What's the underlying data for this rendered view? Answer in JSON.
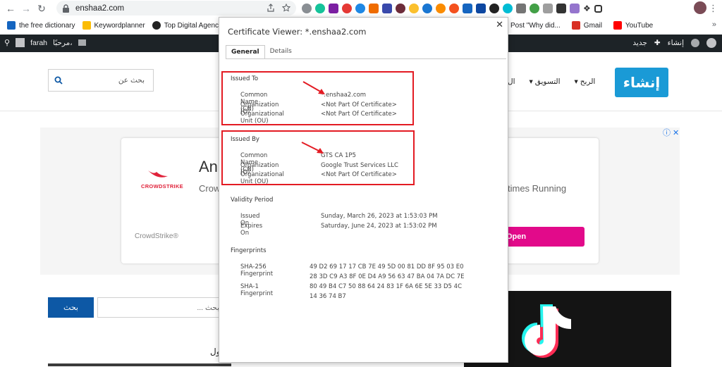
{
  "browser": {
    "url": "enshaa2.com",
    "bookmarks": [
      {
        "label": "the free dictionary",
        "color": "#1565c0"
      },
      {
        "label": "Keywordplanner",
        "color": "#fbbc04"
      },
      {
        "label": "Top Digital Agency",
        "color": "#222"
      }
    ],
    "bookmarks_right": [
      {
        "label": "Post \"Why did...",
        "color": "#e8710a"
      },
      {
        "label": "Gmail",
        "color": "#d93025"
      },
      {
        "label": "YouTube",
        "color": "#ff0000"
      }
    ]
  },
  "wp_bar": {
    "user": "farah",
    "greeting": "مرحبًا،",
    "site": "إنشاء",
    "new": "جديد"
  },
  "site": {
    "search_placeholder": "بحث عن",
    "menu": [
      "الربح",
      "التسويق",
      "ال"
    ],
    "logo": "إنشاء",
    "search_button": "بحث",
    "search2_placeholder": "بحث ...",
    "bottom_text": "ول"
  },
  "ad": {
    "title": "An",
    "subtitle": "Crow",
    "right_text": "times Running",
    "brand": "CrowdStrike®",
    "logo_text": "CROWDSTRIKE",
    "cta": "Open"
  },
  "dialog": {
    "title": "Certificate Viewer: *.enshaa2.com",
    "tabs": [
      "General",
      "Details"
    ],
    "issued_to": {
      "heading": "Issued To",
      "rows": [
        {
          "k": "Common Name (CN)",
          "v": "*.enshaa2.com"
        },
        {
          "k": "Organization (O)",
          "v": "<Not Part Of Certificate>"
        },
        {
          "k": "Organizational Unit (OU)",
          "v": "<Not Part Of Certificate>"
        }
      ]
    },
    "issued_by": {
      "heading": "Issued By",
      "rows": [
        {
          "k": "Common Name (CN)",
          "v": "GTS CA 1P5"
        },
        {
          "k": "Organization (O)",
          "v": "Google Trust Services LLC"
        },
        {
          "k": "Organizational Unit (OU)",
          "v": "<Not Part Of Certificate>"
        }
      ]
    },
    "validity": {
      "heading": "Validity Period",
      "rows": [
        {
          "k": "Issued On",
          "v": "Sunday, March 26, 2023 at 1:53:03 PM"
        },
        {
          "k": "Expires On",
          "v": "Saturday, June 24, 2023 at 1:53:02 PM"
        }
      ]
    },
    "fingerprints": {
      "heading": "Fingerprints",
      "sha256_label": "SHA-256 Fingerprint",
      "sha256_line1": "49 D2 69 17 17 CB 7E 49 5D 00 81 DD 8F 95 03 E0",
      "sha256_line2": "28 3D C9 A3 8F 0E D4 A9 56 63 47 BA 04 7A DC 7E",
      "sha1_label": "SHA-1 Fingerprint",
      "sha1_line1": "80 49 B4 C7 50 88 64 24 83 1F 6A 6E 5E 33 D5 4C",
      "sha1_line2": "14 36 74 B7"
    }
  },
  "colors": {
    "highlight": "#e31b23",
    "wp_bar": "#1d2327",
    "site_blue": "#0d58a5",
    "ad_cta": "#e20a8a"
  }
}
